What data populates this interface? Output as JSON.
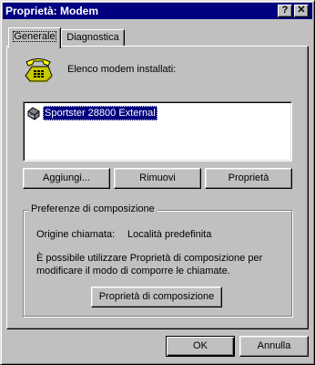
{
  "window": {
    "title": "Proprietà: Modem",
    "help_btn": "?",
    "close_btn": "✕"
  },
  "tabs": [
    {
      "label": "Generale",
      "active": true
    },
    {
      "label": "Diagnostica",
      "active": false
    }
  ],
  "main": {
    "installed_label": "Elenco modem installati:",
    "modems": [
      {
        "name": "Sportster 28800 External",
        "selected": true
      }
    ],
    "buttons": {
      "add": "Aggiungi...",
      "remove": "Rimuovi",
      "properties": "Proprietà"
    }
  },
  "dialing": {
    "group_title": "Preferenze di composizione",
    "origin_label": "Origine chiamata:",
    "origin_value": "Località predefinita",
    "description_line1": "È possibile utilizzare Proprietà di composizione per",
    "description_line2": "modificare il modo di comporre le chiamate.",
    "button": "Proprietà di composizione"
  },
  "footer": {
    "ok": "OK",
    "cancel": "Annulla"
  },
  "colors": {
    "title_bar": "#000080",
    "face": "#c0c0c0",
    "selection": "#000080"
  },
  "icons": {
    "phone": "phone-icon",
    "modem": "modem-icon"
  }
}
